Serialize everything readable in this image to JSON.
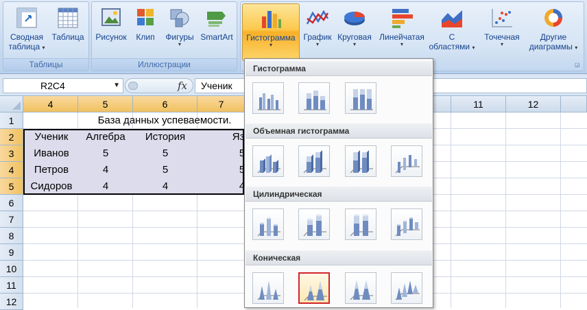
{
  "ribbon": {
    "groups": {
      "tables": {
        "label": "Таблицы"
      },
      "illustrations": {
        "label": "Иллюстрации"
      }
    },
    "buttons": {
      "pivot_line1": "Сводная",
      "pivot_line2": "таблица",
      "table": "Таблица",
      "picture": "Рисунок",
      "clip": "Клип",
      "shapes": "Фигуры",
      "smartart": "SmartArt",
      "histogram": "Гистограмма",
      "graph": "График",
      "pie": "Круговая",
      "linear": "Линейчатая",
      "area_line1": "С",
      "area_line2": "областями",
      "scatter": "Точечная",
      "other_line1": "Другие",
      "other_line2": "диаграммы"
    }
  },
  "formula_bar": {
    "name_box": "R2C4",
    "fx": "fx",
    "value": "Ученик"
  },
  "grid": {
    "column_headers": [
      "4",
      "5",
      "6",
      "7",
      "",
      "",
      "",
      "11",
      "12",
      ""
    ],
    "row_headers": [
      "1",
      "2",
      "3",
      "4",
      "5",
      "6",
      "7",
      "8",
      "9",
      "10",
      "11",
      "12"
    ],
    "title_cell": "База данных успеваемости.",
    "table": {
      "headers": [
        "Ученик",
        "Алгебра",
        "История",
        "Язы"
      ],
      "rows": [
        [
          "Иванов",
          "5",
          "5",
          "5"
        ],
        [
          "Петров",
          "4",
          "5",
          "5"
        ],
        [
          "Сидоров",
          "4",
          "4",
          "4"
        ]
      ]
    }
  },
  "gallery": {
    "sections": [
      {
        "title": "Гистограмма"
      },
      {
        "title": "Объемная гистограмма"
      },
      {
        "title": "Цилиндрическая"
      },
      {
        "title": "Коническая"
      }
    ]
  },
  "colors": {
    "ribbon_bg": "#c9dbf0",
    "active_button": "#f8b028",
    "selection_header": "#f1c15f",
    "highlight_border": "#d2232a"
  }
}
